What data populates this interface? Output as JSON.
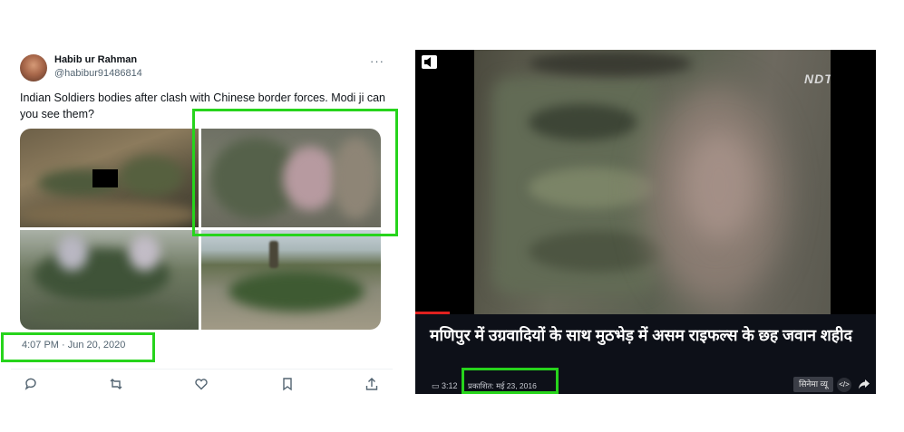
{
  "tweet": {
    "name": "Habib ur Rahman",
    "handle": "@habibur91486814",
    "more": "···",
    "text": "Indian Soldiers bodies after clash with Chinese border forces. Modi ji can you see them?",
    "timestamp": "4:07 PM · Jun 20, 2020",
    "actions": [
      "reply-icon",
      "retweet-icon",
      "like-icon",
      "bookmark-icon",
      "share-icon"
    ]
  },
  "video": {
    "channel_logo": "NDTV",
    "headline": "मणिपुर में उग्रवादियों के साथ मुठभेड़ में असम राइफल्स के छह जवान शहीद",
    "duration": "3:12",
    "published": "प्रकाशित: मई 23, 2016",
    "cinema_label": "सिनेमा व्यू",
    "embed_label": "</>",
    "progress": 0.08
  },
  "colors": {
    "highlight": "#27d41c",
    "progress": "#e0211f",
    "panel": "#0d1018"
  }
}
